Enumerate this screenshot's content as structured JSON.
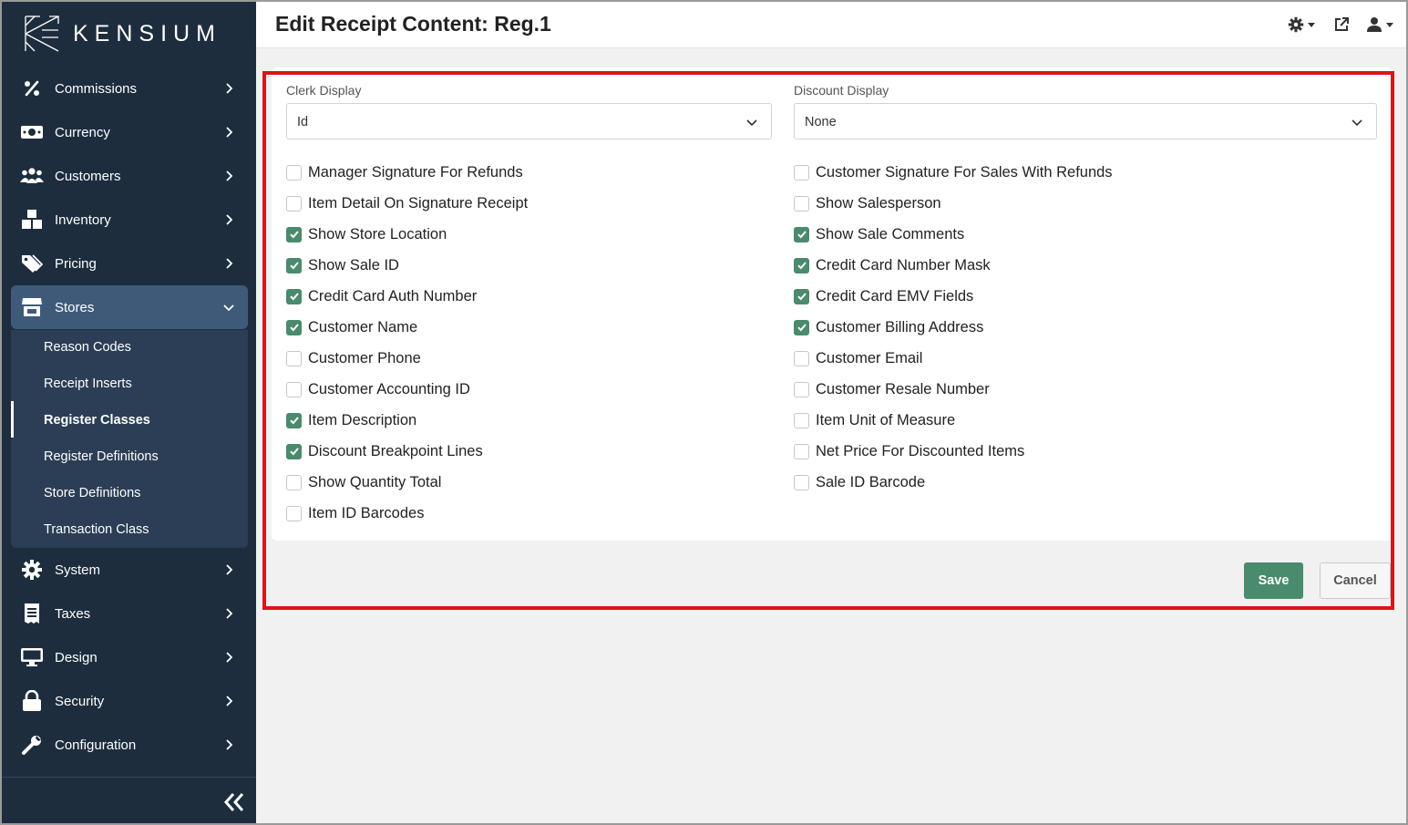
{
  "brand": {
    "name": "KENSIUM"
  },
  "header": {
    "title": "Edit Receipt Content: Reg.1"
  },
  "sidebar": {
    "items": [
      {
        "label": "Commissions",
        "icon": "percent-icon"
      },
      {
        "label": "Currency",
        "icon": "money-icon"
      },
      {
        "label": "Customers",
        "icon": "users-icon"
      },
      {
        "label": "Inventory",
        "icon": "boxes-icon"
      },
      {
        "label": "Pricing",
        "icon": "tags-icon"
      },
      {
        "label": "Stores",
        "icon": "store-icon"
      },
      {
        "label": "System",
        "icon": "gear-icon"
      },
      {
        "label": "Taxes",
        "icon": "receipt-icon"
      },
      {
        "label": "Design",
        "icon": "monitor-icon"
      },
      {
        "label": "Security",
        "icon": "lock-icon"
      },
      {
        "label": "Configuration",
        "icon": "wrench-icon"
      }
    ],
    "submenu": [
      {
        "label": "Reason Codes"
      },
      {
        "label": "Receipt Inserts"
      },
      {
        "label": "Register Classes"
      },
      {
        "label": "Register Definitions"
      },
      {
        "label": "Store Definitions"
      },
      {
        "label": "Transaction Class"
      }
    ]
  },
  "form": {
    "clerk_display": {
      "label": "Clerk Display",
      "value": "Id"
    },
    "discount_display": {
      "label": "Discount Display",
      "value": "None"
    },
    "left": [
      {
        "label": "Manager Signature For Refunds",
        "checked": false
      },
      {
        "label": "Item Detail On Signature Receipt",
        "checked": false
      },
      {
        "label": "Show Store Location",
        "checked": true
      },
      {
        "label": "Show Sale ID",
        "checked": true
      },
      {
        "label": "Credit Card Auth Number",
        "checked": true
      },
      {
        "label": "Customer Name",
        "checked": true
      },
      {
        "label": "Customer Phone",
        "checked": false
      },
      {
        "label": "Customer Accounting ID",
        "checked": false
      },
      {
        "label": "Item Description",
        "checked": true
      },
      {
        "label": "Discount Breakpoint Lines",
        "checked": true
      },
      {
        "label": "Show Quantity Total",
        "checked": false
      },
      {
        "label": "Item ID Barcodes",
        "checked": false
      }
    ],
    "right": [
      {
        "label": "Customer Signature For Sales With Refunds",
        "checked": false
      },
      {
        "label": "Show Salesperson",
        "checked": false
      },
      {
        "label": "Show Sale Comments",
        "checked": true
      },
      {
        "label": "Credit Card Number Mask",
        "checked": true
      },
      {
        "label": "Credit Card EMV Fields",
        "checked": true
      },
      {
        "label": "Customer Billing Address",
        "checked": true
      },
      {
        "label": "Customer Email",
        "checked": false
      },
      {
        "label": "Customer Resale Number",
        "checked": false
      },
      {
        "label": "Item Unit of Measure",
        "checked": false
      },
      {
        "label": "Net Price For Discounted Items",
        "checked": false
      },
      {
        "label": "Sale ID Barcode",
        "checked": false
      }
    ]
  },
  "actions": {
    "save": "Save",
    "cancel": "Cancel"
  },
  "colors": {
    "sidebar": "#1d2d3e",
    "accent": "#4a8a6d",
    "highlight": "#e0121b"
  }
}
